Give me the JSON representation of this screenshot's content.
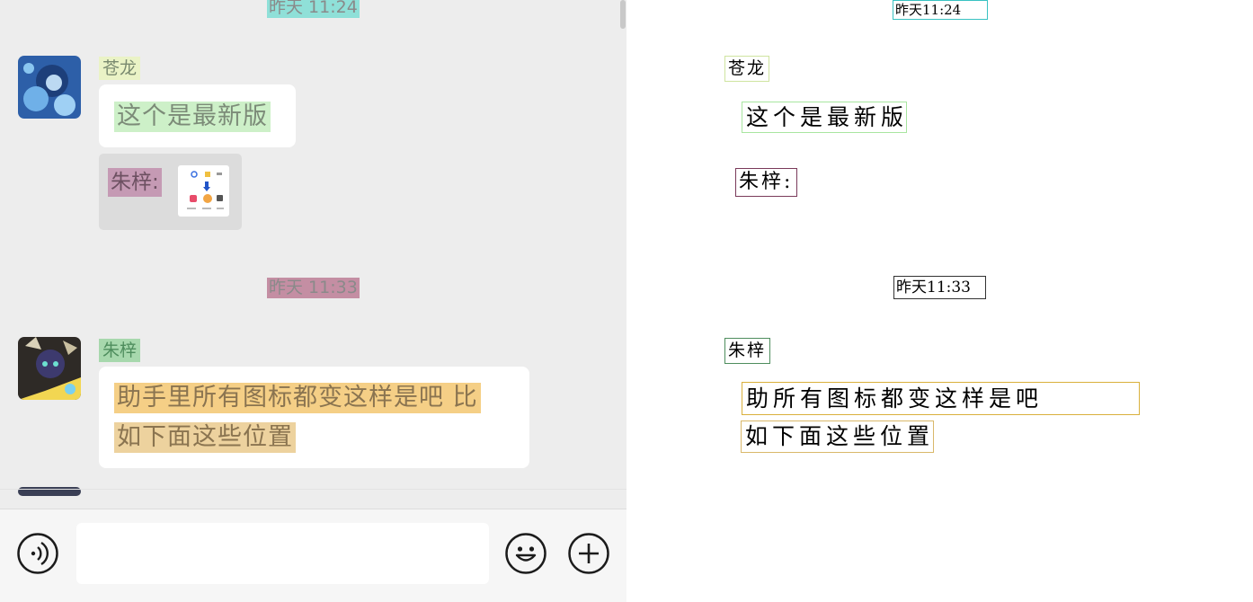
{
  "chat": {
    "timestamp_1": "昨天 11:24",
    "timestamp_2": "昨天 11:33",
    "messages": [
      {
        "sender": "苍龙",
        "text": "这个是最新版",
        "quote_label": "朱梓:"
      },
      {
        "sender": "朱梓",
        "line1": "助手里所有图标都变这样是吧 比",
        "line2": "如下面这些位置"
      }
    ],
    "input_bar": {
      "left_icon": "voice-icon",
      "right_icons": [
        "emoji-icon",
        "plus-icon"
      ],
      "placeholder": ""
    }
  },
  "ocr_boxes": {
    "timestamp_1": "昨天11:24",
    "sender_1": "苍龙",
    "message_1": "这个是最新版",
    "quote_label": "朱梓:",
    "timestamp_2": "昨天11:33",
    "sender_2": "朱梓",
    "line_1": "助所有图标都变这样是吧",
    "line_2": "如下面这些位置"
  },
  "colors": {
    "chat_background": "#ededed",
    "bubble": "#ffffff",
    "ts1_highlight": "#8fe0d8",
    "ts2_highlight": "#c48ea3",
    "sender1_highlight": "#eaf3c6",
    "sender2_highlight": "#a7d8ad",
    "msg1_highlight": "#cdf0c8",
    "msg2_highlight": "#f5cf86",
    "quote_highlight": "#c59ab4"
  }
}
